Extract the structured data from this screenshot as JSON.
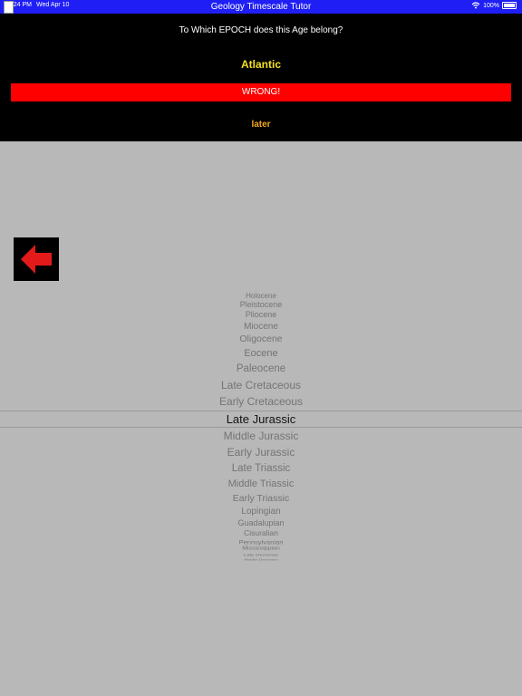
{
  "status_bar": {
    "time": "12:24 PM",
    "date": "Wed Apr 10",
    "title": "Geology Timescale Tutor",
    "battery": "100%"
  },
  "quiz": {
    "question": "To Which EPOCH does this Age belong?",
    "age": "Atlantic",
    "result": "WRONG!",
    "later": "later"
  },
  "colors": {
    "status_bar": "#1f1ff5",
    "age_text": "#f4e01f",
    "result_bg": "#ff0000",
    "later_text": "#f4a81f",
    "arrow": "#e21a1a"
  },
  "icons": {
    "back": "left-arrow-icon"
  },
  "picker": {
    "selected": "Late Jurassic",
    "items": [
      "Holocene",
      "Pleistocene",
      "Pliocene",
      "Miocene",
      "Oligocene",
      "Eocene",
      "Paleocene",
      "Late Cretaceous",
      "Early Cretaceous",
      "Late Jurassic",
      "Middle Jurassic",
      "Early Jurassic",
      "Late Triassic",
      "Middle Triassic",
      "Early Triassic",
      "Lopingian",
      "Guadalupian",
      "Cisuralian",
      "Pennsylvanian",
      "Mississippian",
      "Late Devonian",
      "Middle Devonian"
    ]
  }
}
